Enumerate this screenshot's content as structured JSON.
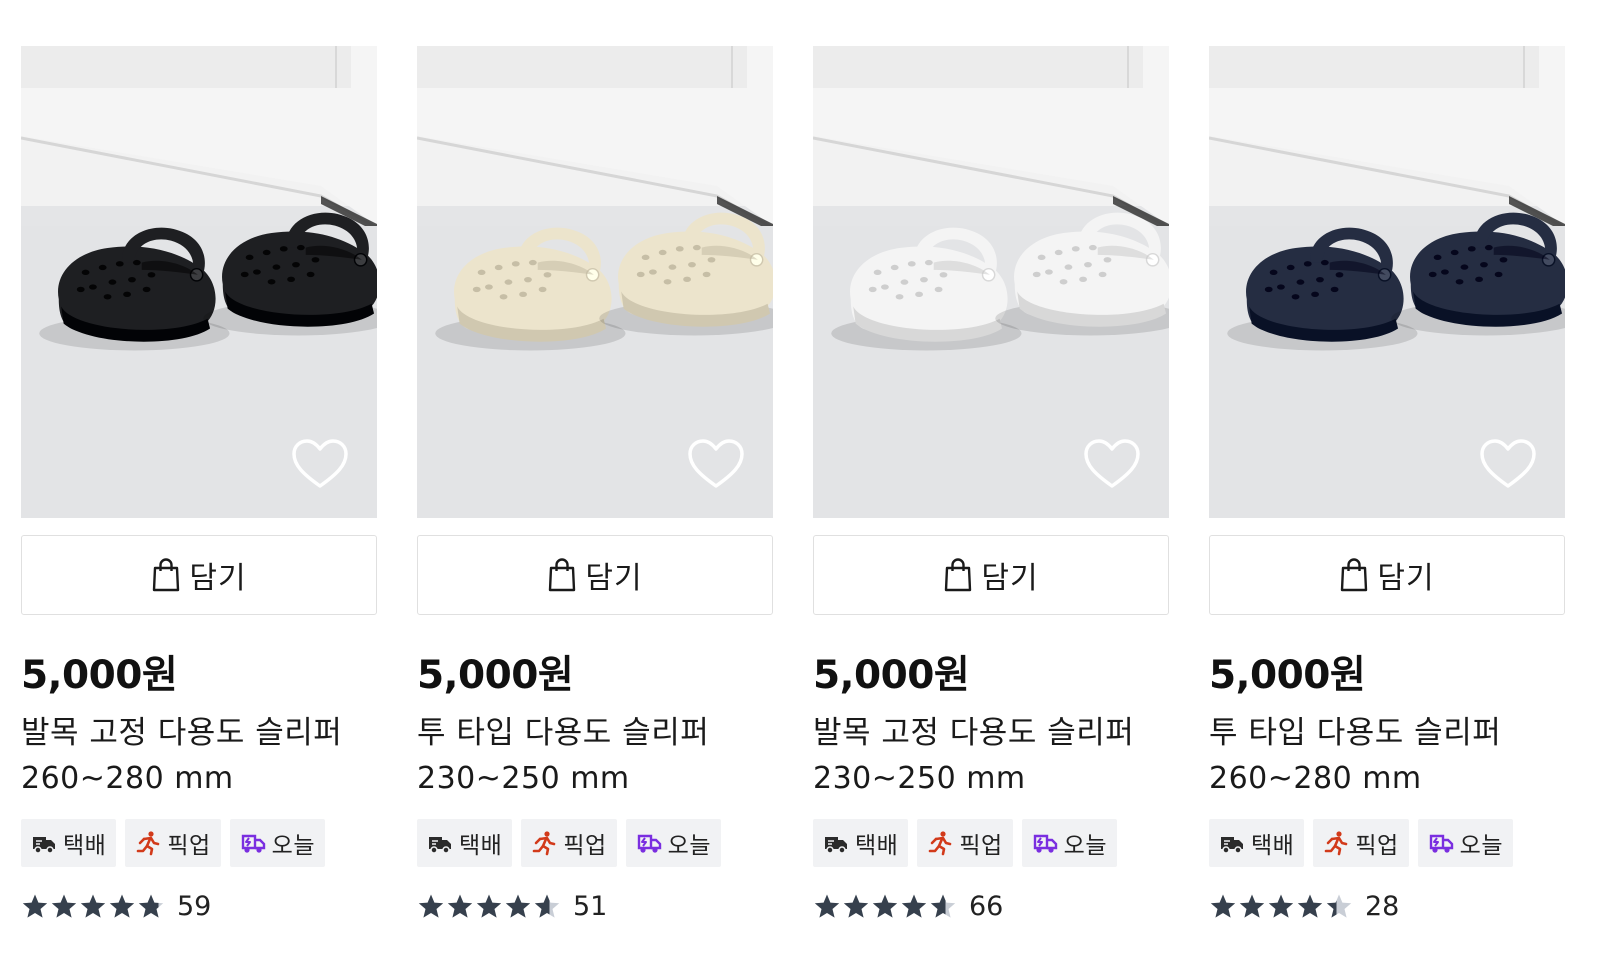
{
  "products": [
    {
      "price": "5,000원",
      "name": "발목 고정 다용도 슬리퍼",
      "size": "260~280 mm",
      "add_label": "담기",
      "tags": [
        "택배",
        "픽업",
        "오늘"
      ],
      "rating": 4.8,
      "review_count": "59",
      "shoe_color": "#1e1f22"
    },
    {
      "price": "5,000원",
      "name": "투 타입 다용도 슬리퍼",
      "size": "230~250 mm",
      "add_label": "담기",
      "tags": [
        "택배",
        "픽업",
        "오늘"
      ],
      "rating": 4.6,
      "review_count": "51",
      "shoe_color": "#ece4cc"
    },
    {
      "price": "5,000원",
      "name": "발목 고정 다용도 슬리퍼",
      "size": "230~250 mm",
      "add_label": "담기",
      "tags": [
        "택배",
        "픽업",
        "오늘"
      ],
      "rating": 4.6,
      "review_count": "66",
      "shoe_color": "#f4f4f4"
    },
    {
      "price": "5,000원",
      "name": "투 타입 다용도 슬리퍼",
      "size": "260~280 mm",
      "add_label": "담기",
      "tags": [
        "택배",
        "픽업",
        "오늘"
      ],
      "rating": 4.4,
      "review_count": "28",
      "shoe_color": "#252d42"
    }
  ],
  "colors": {
    "star": "#36404d",
    "star_empty": "#c9ced6",
    "tag_bg": "#f1f2f4",
    "delivery_icon": "#2b2b2b",
    "pickup_icon": "#d23a1a",
    "today_icon": "#7a2ee0"
  }
}
